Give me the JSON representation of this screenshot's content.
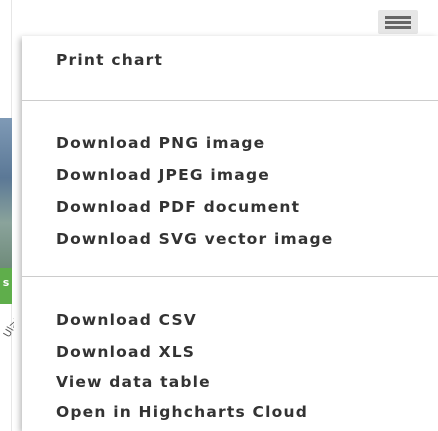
{
  "background": {
    "left_badge": "s",
    "left_axis_text": "Ul>y v"
  },
  "export_menu": {
    "button_icon": "hamburger-menu-icon",
    "items": [
      {
        "label": "Print chart"
      },
      {
        "label": "Download PNG image"
      },
      {
        "label": "Download JPEG image"
      },
      {
        "label": "Download PDF document"
      },
      {
        "label": "Download SVG vector image"
      },
      {
        "label": "Download CSV"
      },
      {
        "label": "Download XLS"
      },
      {
        "label": "View data table"
      },
      {
        "label": "Open in Highcharts Cloud"
      }
    ]
  },
  "colors": {
    "menu_text": "#333333",
    "button_bg": "#e6e6e6",
    "button_icon": "#666666",
    "separator": "#cccccc"
  }
}
